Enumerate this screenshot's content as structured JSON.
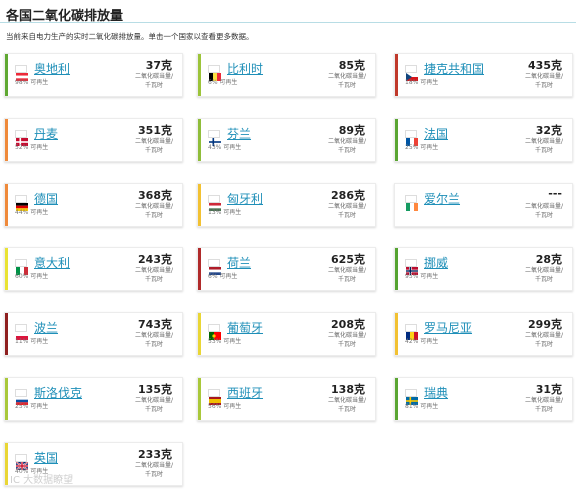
{
  "header": {
    "title": "各国二氧化碳排放量",
    "subtitle": "当前来自电力生产的实时二氧化碳排放量。单击一个国家以查看更多数据。"
  },
  "unit_label": "二氧化碳当量/千瓦时",
  "watermark": "IC 大数据瞭望",
  "cards": [
    {
      "name": "奥地利",
      "value": "37克",
      "renewable": "98% 可再生",
      "bar": "#5fa832",
      "flag": [
        "#ed2939",
        "#ffffff",
        "#ed2939"
      ],
      "flag_dir": "h"
    },
    {
      "name": "比利时",
      "value": "85克",
      "renewable": "6% 可再生",
      "bar": "#9cc43a",
      "flag": [
        "#000000",
        "#fae042",
        "#ed2939"
      ],
      "flag_dir": "v"
    },
    {
      "name": "捷克共和国",
      "value": "435克",
      "renewable": "18% 可再生",
      "bar": "#c0392b",
      "flag": [
        "#ffffff",
        "#d7141a"
      ],
      "flag_dir": "czech"
    },
    {
      "name": "丹麦",
      "value": "351克",
      "renewable": "52% 可再生",
      "bar": "#ef8a3b",
      "flag": [
        "#c60c30",
        "#ffffff"
      ],
      "flag_dir": "nordic"
    },
    {
      "name": "芬兰",
      "value": "89克",
      "renewable": "43% 可再生",
      "bar": "#8fbd3a",
      "flag": [
        "#ffffff",
        "#003580"
      ],
      "flag_dir": "nordic"
    },
    {
      "name": "法国",
      "value": "32克",
      "renewable": "25% 可再生",
      "bar": "#5aa532",
      "flag": [
        "#0055a4",
        "#ffffff",
        "#ef4135"
      ],
      "flag_dir": "v"
    },
    {
      "name": "德国",
      "value": "368克",
      "renewable": "44% 可再生",
      "bar": "#ef8a3b",
      "flag": [
        "#000000",
        "#dd0000",
        "#ffce00"
      ],
      "flag_dir": "h"
    },
    {
      "name": "匈牙利",
      "value": "286克",
      "renewable": "13% 可再生",
      "bar": "#f2c132",
      "flag": [
        "#ce2939",
        "#ffffff",
        "#477050"
      ],
      "flag_dir": "h"
    },
    {
      "name": "爱尔兰",
      "value": "---",
      "renewable": "",
      "bar": "#ffffff",
      "flag": [
        "#169b62",
        "#ffffff",
        "#ff883e"
      ],
      "flag_dir": "v"
    },
    {
      "name": "意大利",
      "value": "243克",
      "renewable": "60% 可再生",
      "bar": "#e9e334",
      "flag": [
        "#009246",
        "#ffffff",
        "#ce2b37"
      ],
      "flag_dir": "v"
    },
    {
      "name": "荷兰",
      "value": "625克",
      "renewable": "6% 可再生",
      "bar": "#b02a2a",
      "flag": [
        "#ae1c28",
        "#ffffff",
        "#21468b"
      ],
      "flag_dir": "h"
    },
    {
      "name": "挪威",
      "value": "28克",
      "renewable": "95% 可再生",
      "bar": "#55a331",
      "flag": [
        "#ba0c2f",
        "#ffffff",
        "#00205b"
      ],
      "flag_dir": "norway"
    },
    {
      "name": "波兰",
      "value": "743克",
      "renewable": "11% 可再生",
      "bar": "#8e1f1f",
      "flag": [
        "#ffffff",
        "#dc143c"
      ],
      "flag_dir": "h"
    },
    {
      "name": "葡萄牙",
      "value": "208克",
      "renewable": "53% 可再生",
      "bar": "#e9d635",
      "flag": [
        "#006600",
        "#ff0000"
      ],
      "flag_dir": "pt"
    },
    {
      "name": "罗马尼亚",
      "value": "299克",
      "renewable": "42% 可再生",
      "bar": "#f2c132",
      "flag": [
        "#002b7f",
        "#fcd116",
        "#ce1126"
      ],
      "flag_dir": "v"
    },
    {
      "name": "斯洛伐克",
      "value": "135克",
      "renewable": "25% 可再生",
      "bar": "#a9c83a",
      "flag": [
        "#ffffff",
        "#0b4ea2",
        "#ee1c25"
      ],
      "flag_dir": "h"
    },
    {
      "name": "西班牙",
      "value": "138克",
      "renewable": "56% 可再生",
      "bar": "#a9c83a",
      "flag": [
        "#aa151b",
        "#f1bf00",
        "#aa151b"
      ],
      "flag_dir": "es"
    },
    {
      "name": "瑞典",
      "value": "31克",
      "renewable": "81% 可再生",
      "bar": "#5aa532",
      "flag": [
        "#006aa7",
        "#fecc00"
      ],
      "flag_dir": "nordic"
    },
    {
      "name": "英国",
      "value": "233克",
      "renewable": "40% 可再生",
      "bar": "#e9d635",
      "flag": [
        "#012169",
        "#ffffff",
        "#c8102e"
      ],
      "flag_dir": "uk"
    }
  ]
}
